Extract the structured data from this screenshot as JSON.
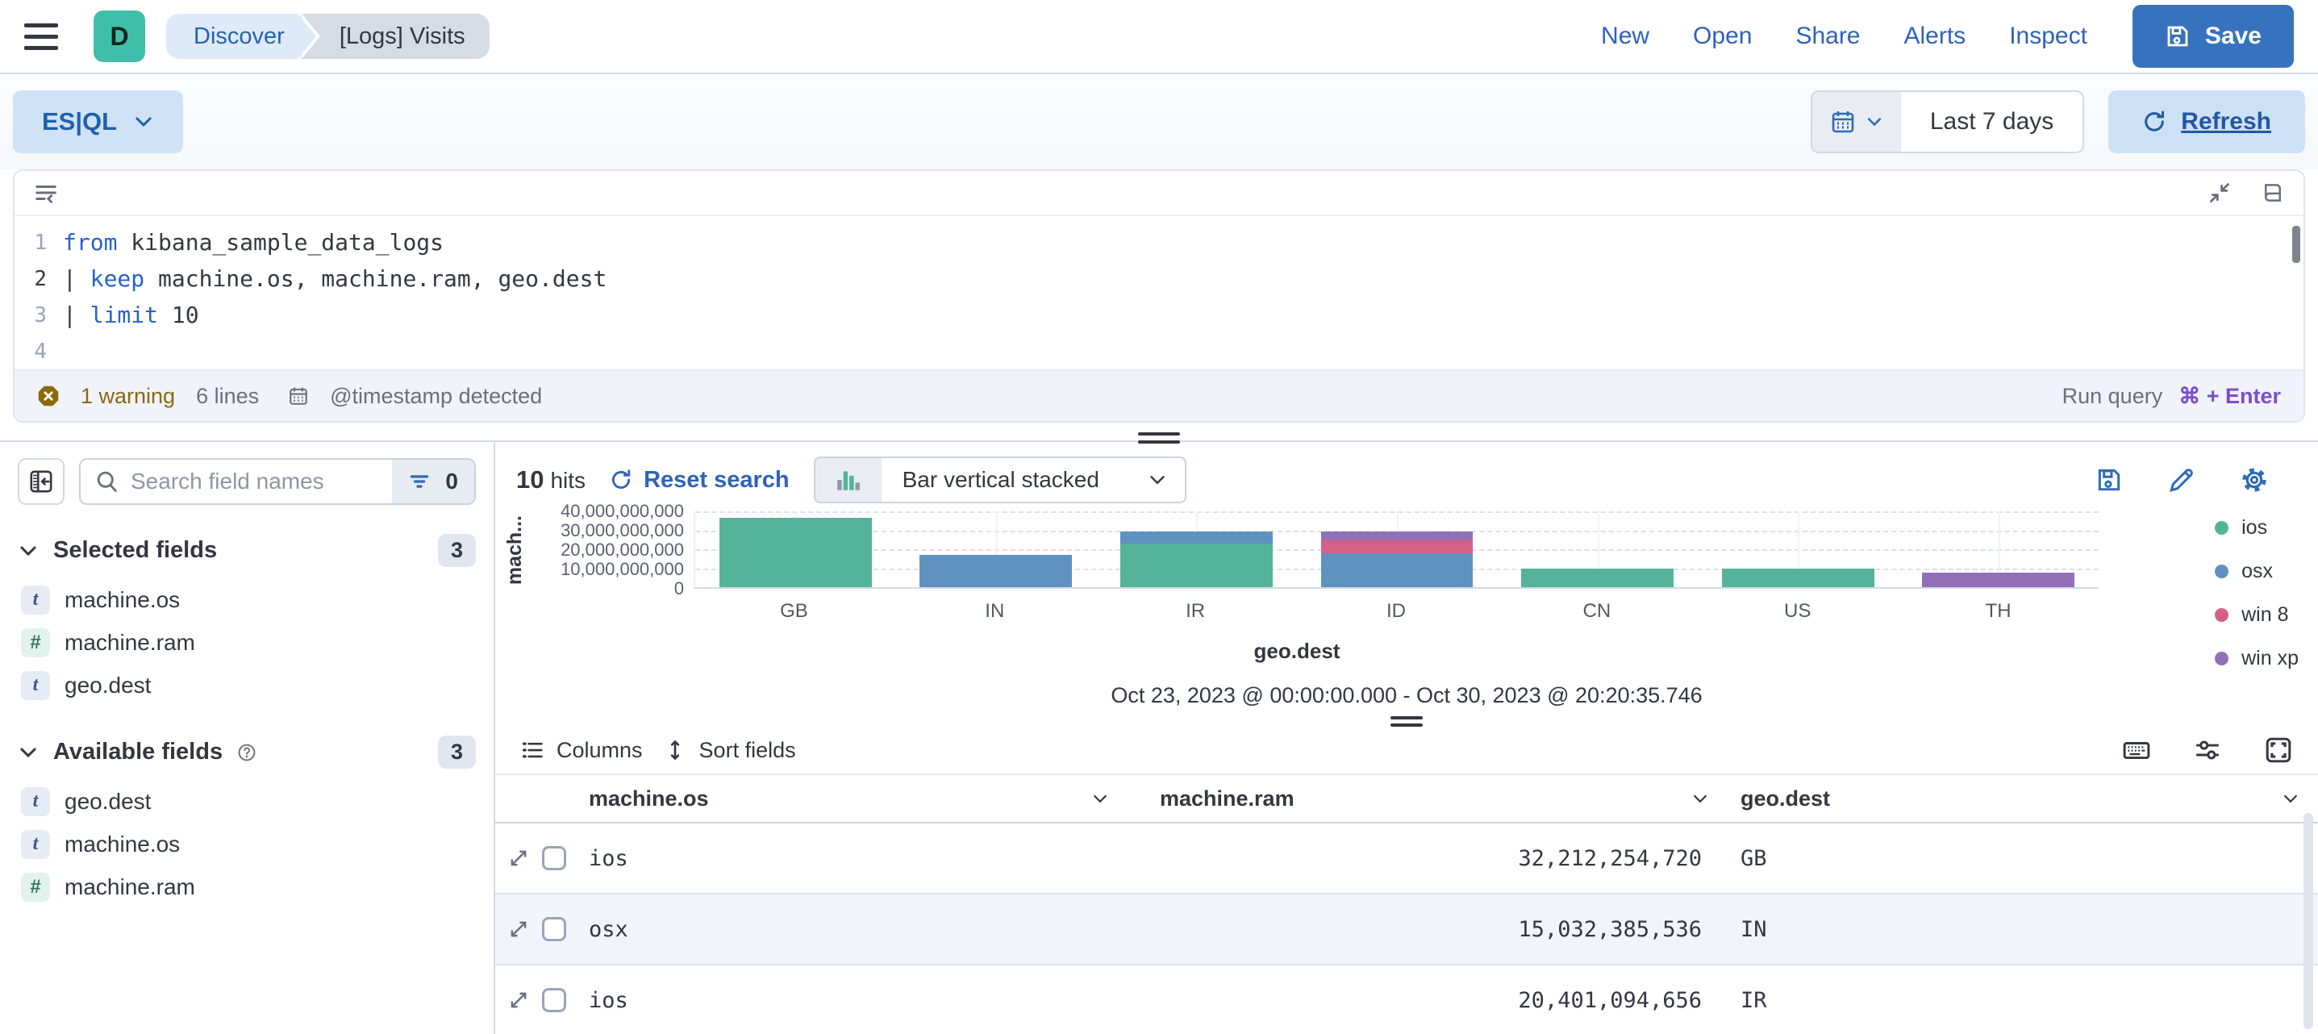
{
  "header": {
    "logo": "D",
    "breadcrumbs": {
      "first": "Discover",
      "second": "[Logs] Visits"
    },
    "nav": {
      "new": "New",
      "open": "Open",
      "share": "Share",
      "alerts": "Alerts",
      "inspect": "Inspect"
    },
    "save_label": "Save"
  },
  "query_bar": {
    "language": "ES|QL",
    "time_range": "Last 7 days",
    "refresh_label": "Refresh"
  },
  "editor": {
    "lines": [
      {
        "number": "1",
        "tokens": [
          {
            "text": "from",
            "type": "keyword"
          },
          {
            "text": " kibana_sample_data_logs",
            "type": "plain"
          }
        ]
      },
      {
        "number": "2",
        "tokens": [
          {
            "text": "| ",
            "type": "plain"
          },
          {
            "text": "keep",
            "type": "keyword"
          },
          {
            "text": " machine.os, machine.ram, geo.dest",
            "type": "plain"
          }
        ]
      },
      {
        "number": "3",
        "tokens": [
          {
            "text": "| ",
            "type": "plain"
          },
          {
            "text": "limit",
            "type": "keyword"
          },
          {
            "text": " 10",
            "type": "plain"
          }
        ]
      },
      {
        "number": "4",
        "tokens": []
      }
    ],
    "footer": {
      "warning": "1 warning",
      "lines_count": "6 lines",
      "timestamp_note": "@timestamp detected",
      "run_query": "Run query",
      "shortcut": "⌘ + Enter"
    }
  },
  "sidebar": {
    "search_placeholder": "Search field names",
    "filter_count": "0",
    "selected": {
      "title": "Selected fields",
      "count": "3",
      "items": [
        {
          "token": "t",
          "name": "machine.os"
        },
        {
          "token": "#",
          "name": "machine.ram"
        },
        {
          "token": "t",
          "name": "geo.dest"
        }
      ]
    },
    "available": {
      "title": "Available fields",
      "count": "3",
      "items": [
        {
          "token": "t",
          "name": "geo.dest"
        },
        {
          "token": "t",
          "name": "machine.os"
        },
        {
          "token": "#",
          "name": "machine.ram"
        }
      ]
    }
  },
  "results": {
    "hits_count": "10",
    "hits_label": "hits",
    "reset_label": "Reset search",
    "chart_type": "Bar vertical stacked",
    "time_range_note": "Oct 23, 2023 @ 00:00:00.000 - Oct 30, 2023 @ 20:20:35.746"
  },
  "chart_data": {
    "type": "bar",
    "stacked": true,
    "xlabel": "geo.dest",
    "ylabel": "mach...",
    "categories": [
      "GB",
      "IN",
      "IR",
      "ID",
      "CN",
      "US",
      "TH"
    ],
    "series": [
      {
        "name": "ios",
        "color": "#54B399",
        "values": [
          36500000000,
          0,
          23000000000,
          0,
          10000000000,
          10000000000,
          0
        ]
      },
      {
        "name": "osx",
        "color": "#6092C0",
        "values": [
          0,
          17000000000,
          6500000000,
          18000000000,
          0,
          0,
          0
        ]
      },
      {
        "name": "win 8",
        "color": "#D36086",
        "values": [
          0,
          0,
          0,
          6500000000,
          0,
          0,
          0
        ]
      },
      {
        "name": "win xp",
        "color": "#9170B8",
        "values": [
          0,
          0,
          0,
          5000000000,
          0,
          0,
          7500000000
        ]
      }
    ],
    "ylim": [
      0,
      40000000000
    ],
    "yticks": [
      "40,000,000,000",
      "30,000,000,000",
      "20,000,000,000",
      "10,000,000,000",
      "0"
    ],
    "grid": true,
    "legend_position": "right"
  },
  "table": {
    "toolbar": {
      "columns_label": "Columns",
      "sort_label": "Sort fields"
    },
    "headers": [
      "machine.os",
      "machine.ram",
      "geo.dest"
    ],
    "rows": [
      {
        "os": "ios",
        "ram": "32,212,254,720",
        "dest": "GB"
      },
      {
        "os": "osx",
        "ram": "15,032,385,536",
        "dest": "IN"
      },
      {
        "os": "ios",
        "ram": "20,401,094,656",
        "dest": "IR"
      }
    ]
  }
}
